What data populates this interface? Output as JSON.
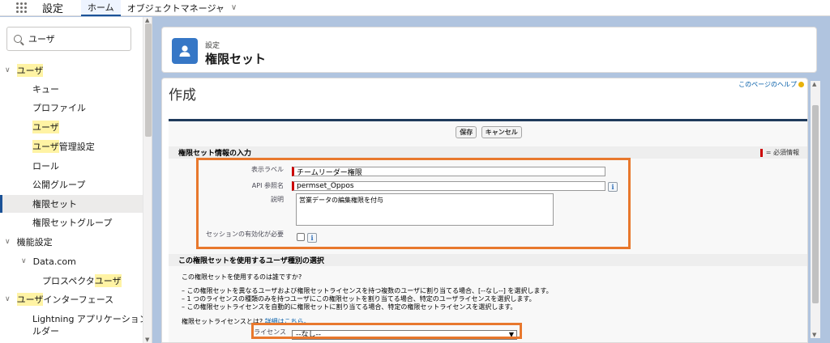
{
  "topbar": {
    "app_name": "設定",
    "tabs": [
      {
        "label": "ホーム"
      },
      {
        "label": "オブジェクトマネージャ"
      }
    ]
  },
  "sidebar": {
    "search_value": "ユーザ",
    "items": [
      {
        "label": "ユーザ"
      },
      {
        "label": "キュー"
      },
      {
        "label": "プロファイル"
      },
      {
        "label": "ユーザ"
      },
      {
        "label": "ユーザ",
        "suffix": "管理設定"
      },
      {
        "label": "ロール"
      },
      {
        "label": "公開グループ"
      },
      {
        "label": "権限セット"
      },
      {
        "label": "権限セットグループ"
      },
      {
        "label": "機能設定"
      },
      {
        "label": "Data.com"
      },
      {
        "prefix": "プロスペクタ",
        "label": "ユーザ"
      },
      {
        "label": "ユーザ",
        "suffix": "インターフェース"
      },
      {
        "line1": "Lightning アプリケーションビ",
        "line2": "ルダー"
      }
    ]
  },
  "header": {
    "breadcrumb": "設定",
    "title": "権限セット"
  },
  "content": {
    "heading": "作成",
    "help_link": "このページのヘルプ",
    "buttons": {
      "save": "保存",
      "cancel": "キャンセル"
    },
    "section1": {
      "title": "権限セット情報の入力",
      "required_legend": "= 必須情報",
      "fields": {
        "label_label": "表示ラベル",
        "label_value": "チームリーダー権限",
        "api_label": "API 参照名",
        "api_value": "permset_Oppos",
        "desc_label": "説明",
        "desc_value": "営業データの編集権限を付与",
        "session_label": "セッションの有効化が必要"
      }
    },
    "section2": {
      "title": "この権限セットを使用するユーザ種別の選択",
      "question": "この権限セットを使用するのは誰ですか?",
      "bullets": [
        "– この権限セットを異なるユーザおよび権限セットライセンスを持つ複数のユーザに割り当てる場合、[--なし--] を選択します。",
        "– 1 つのライセンスの種類のみを持つユーザにこの権限セットを割り当てる場合、特定のユーザライセンスを選択します。",
        "– この権限セットライセンスを自動的に権限セットに割り当てる場合、特定の権限セットライセンスを選択します。"
      ],
      "lic_question": "権限セットライセンスとは?",
      "lic_link": "詳細はこちら。",
      "license_label": "ライセンス",
      "license_value": "--なし--"
    }
  },
  "colors": {
    "brand": "#1b5297",
    "icon_bg": "#3677c6",
    "highlight": "#fff3a4",
    "annotation": "#e8782d",
    "required": "#cc0000"
  }
}
